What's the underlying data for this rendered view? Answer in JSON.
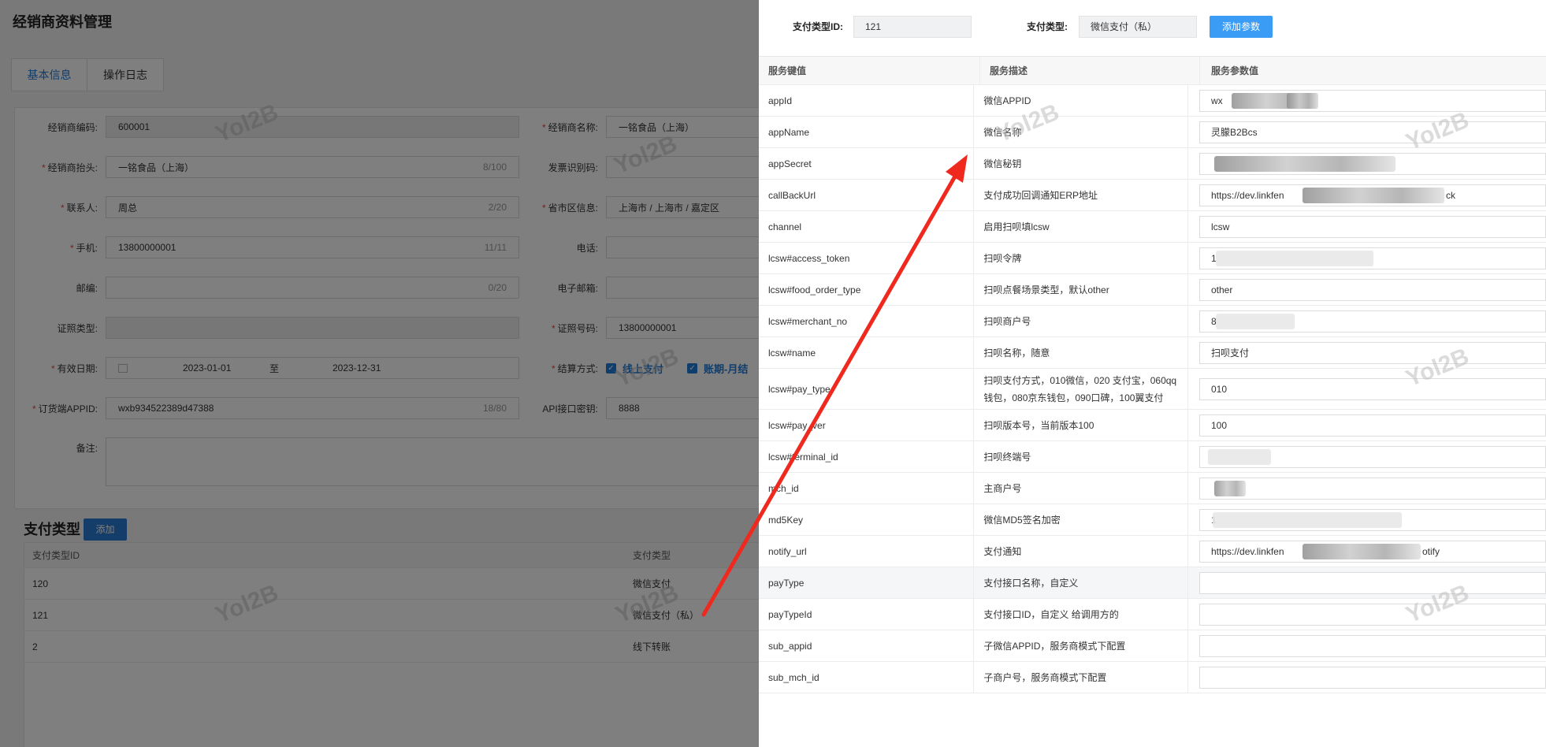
{
  "page": {
    "title": "经销商资料管理",
    "tabs": [
      {
        "label": "基本信息",
        "active": true
      },
      {
        "label": "操作日志",
        "active": false
      }
    ]
  },
  "form": {
    "code_label": "经销商编码:",
    "code_value": "600001",
    "name_label": "经销商名称:",
    "name_value": "一铭食品（上海）",
    "invoice_title_label": "经销商抬头:",
    "invoice_title_value": "一铭食品（上海）",
    "invoice_title_count": "8/100",
    "tax_id_label": "发票识别码:",
    "contact_label": "联系人:",
    "contact_value": "周总",
    "contact_count": "2/20",
    "region_label": "省市区信息:",
    "region_value": "上海市 / 上海市 / 嘉定区",
    "mobile_label": "手机:",
    "mobile_value": "13800000001",
    "mobile_count": "11/11",
    "phone_label": "电话:",
    "zip_label": "邮编:",
    "zip_count": "0/20",
    "email_label": "电子邮箱:",
    "cert_type_label": "证照类型:",
    "cert_no_label": "证照号码:",
    "cert_no_value": "13800000001",
    "valid_label": "有效日期:",
    "valid_start": "2023-01-01",
    "valid_to": "至",
    "valid_end": "2023-12-31",
    "settle_label": "结算方式:",
    "settle_online": "线上支付",
    "settle_monthly": "账期-月结",
    "appid_label": "订货端APPID:",
    "appid_value": "wxb934522389d47388",
    "appid_count": "18/80",
    "api_key_label": "API接口密钥:",
    "api_key_value": "8888",
    "remark_label": "备注:"
  },
  "payment_types": {
    "title": "支付类型",
    "add_label": "添加",
    "headers": [
      "支付类型ID",
      "支付类型"
    ],
    "rows": [
      {
        "id": "120",
        "type": "微信支付"
      },
      {
        "id": "121",
        "type": "微信支付（私）"
      },
      {
        "id": "2",
        "type": "线下转账"
      }
    ]
  },
  "watermark": "Yol2B",
  "drawer": {
    "id_label": "支付类型ID:",
    "id_value": "121",
    "type_label": "支付类型:",
    "type_value": "微信支付（私）",
    "add_param_label": "添加参数",
    "headers": [
      "服务键值",
      "服务描述",
      "服务参数值"
    ],
    "params": [
      {
        "key": "appId",
        "desc": "微信APPID",
        "value": "wx",
        "masked": true
      },
      {
        "key": "appName",
        "desc": "微信名称",
        "value": "灵朦B2Bcs",
        "masked": false
      },
      {
        "key": "appSecret",
        "desc": "微信秘钥",
        "value": "",
        "masked": true
      },
      {
        "key": "callBackUrl",
        "desc": "支付成功回调通知ERP地址",
        "value": "https://dev.linkfen",
        "suffix": "ck",
        "masked": true
      },
      {
        "key": "channel",
        "desc": "启用扫呗填lcsw",
        "value": "lcsw",
        "masked": false
      },
      {
        "key": "lcsw#access_token",
        "desc": "扫呗令牌",
        "value": "1",
        "masked": true
      },
      {
        "key": "lcsw#food_order_type",
        "desc": "扫呗点餐场景类型，默认other",
        "value": "other",
        "masked": false
      },
      {
        "key": "lcsw#merchant_no",
        "desc": "扫呗商户号",
        "value": "8",
        "masked": true
      },
      {
        "key": "lcsw#name",
        "desc": "扫呗名称，随意",
        "value": "扫呗支付",
        "masked": false
      },
      {
        "key": "lcsw#pay_type",
        "desc": "扫呗支付方式，010微信，020 支付宝，060qq钱包，080京东钱包，090口碑，100翼支付",
        "value": "010",
        "masked": false
      },
      {
        "key": "lcsw#pay_ver",
        "desc": "扫呗版本号，当前版本100",
        "value": "100",
        "masked": false
      },
      {
        "key": "lcsw#terminal_id",
        "desc": "扫呗终端号",
        "value": "",
        "masked": true
      },
      {
        "key": "mch_id",
        "desc": "主商户号",
        "value": "",
        "masked": true
      },
      {
        "key": "md5Key",
        "desc": "微信MD5签名加密",
        "value": "1",
        "masked": true
      },
      {
        "key": "notify_url",
        "desc": "支付通知",
        "value": "https://dev.linkfen",
        "suffix": "otify",
        "masked": true
      },
      {
        "key": "payType",
        "desc": "支付接口名称，自定义",
        "value": "",
        "masked": false
      },
      {
        "key": "payTypeId",
        "desc": "支付接口ID，自定义 给调用方的",
        "value": "",
        "masked": false
      },
      {
        "key": "sub_appid",
        "desc": "子微信APPID，服务商模式下配置",
        "value": "",
        "masked": false
      },
      {
        "key": "sub_mch_id",
        "desc": "子商户号，服务商模式下配置",
        "value": "",
        "masked": false
      }
    ]
  },
  "colors": {
    "primary": "#1e7ad9",
    "button": "#3b9cf5",
    "arrow": "#f0291f",
    "overlay": "rgba(0,0,0,0.5)"
  }
}
